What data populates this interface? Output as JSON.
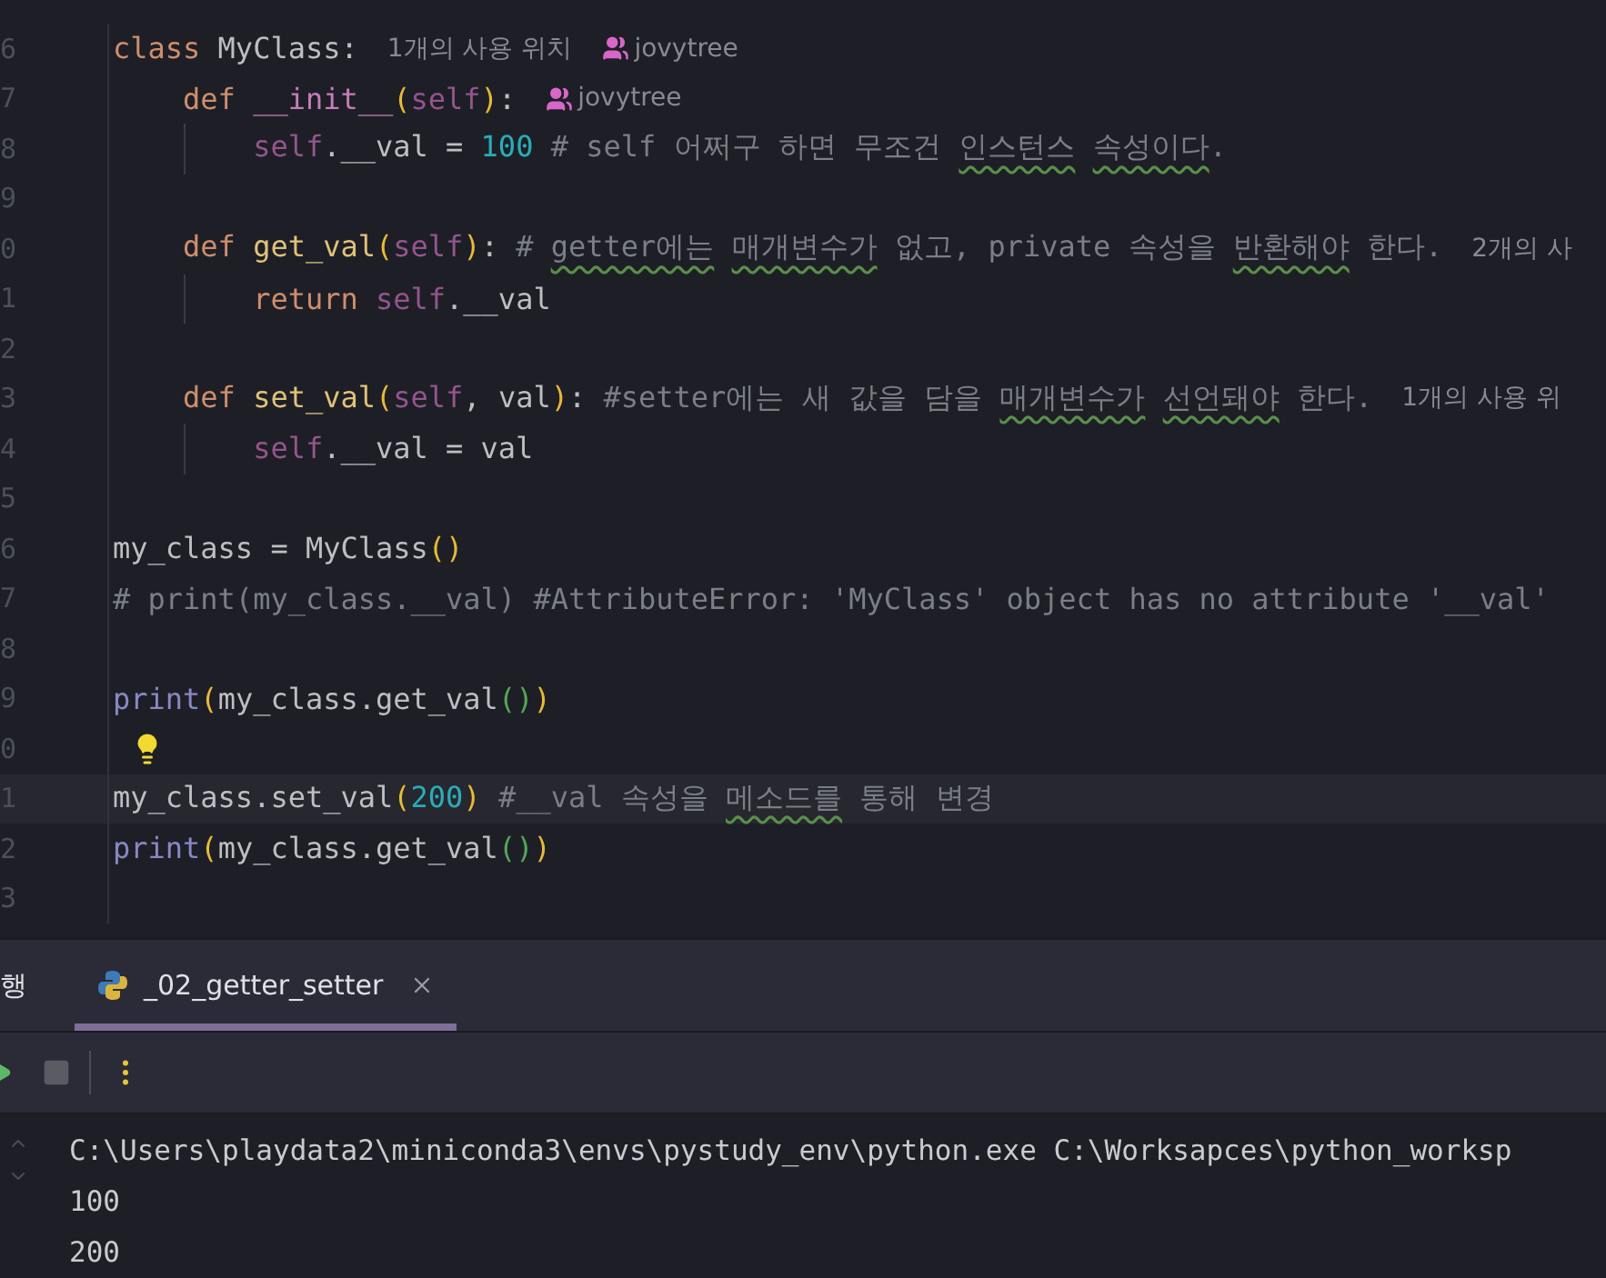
{
  "editor": {
    "lines": [
      {
        "number": "6",
        "tokens": [
          {
            "kind": "kw",
            "text": "class "
          },
          {
            "kind": "plain",
            "text": "MyClass"
          },
          {
            "kind": "plain",
            "text": ":"
          }
        ],
        "hints": [
          {
            "kind": "usages",
            "text": "1개의 사용 위치"
          },
          {
            "kind": "author",
            "text": "jovytree"
          }
        ]
      },
      {
        "number": "7",
        "tokens": [
          {
            "kind": "kw",
            "text": "    def "
          },
          {
            "kind": "magic",
            "text": "__init__"
          },
          {
            "kind": "p1",
            "text": "("
          },
          {
            "kind": "self",
            "text": "self"
          },
          {
            "kind": "p1",
            "text": ")"
          },
          {
            "kind": "plain",
            "text": ":"
          }
        ],
        "hints": [
          {
            "kind": "author",
            "text": "jovytree"
          }
        ]
      },
      {
        "number": "8",
        "guide": true,
        "tokens": [
          {
            "kind": "self",
            "text": "        self"
          },
          {
            "kind": "plain",
            "text": ".__val = "
          },
          {
            "kind": "num",
            "text": "100"
          },
          {
            "kind": "comment",
            "text": " # self 어쩌구 하면 무조건 "
          },
          {
            "kind": "typo",
            "text": "인스턴스"
          },
          {
            "kind": "typo",
            "text": " 속성이다"
          },
          {
            "kind": "comment",
            "text": "."
          }
        ]
      },
      {
        "number": "9"
      },
      {
        "number": "0",
        "tokens": [
          {
            "kind": "kw",
            "text": "    def "
          },
          {
            "kind": "fn",
            "text": "get_val"
          },
          {
            "kind": "p1",
            "text": "("
          },
          {
            "kind": "self",
            "text": "self"
          },
          {
            "kind": "p1",
            "text": ")"
          },
          {
            "kind": "plain",
            "text": ": "
          },
          {
            "kind": "comment",
            "text": "# "
          },
          {
            "kind": "typo",
            "text": "getter에는"
          },
          {
            "kind": "typo",
            "text": " 매개변수가"
          },
          {
            "kind": "comment",
            "text": " 없고, private 속성을 "
          },
          {
            "kind": "typo",
            "text": "반환해야"
          },
          {
            "kind": "comment",
            "text": " 한다."
          }
        ],
        "hints": [
          {
            "kind": "usages",
            "text": "2개의 사"
          }
        ]
      },
      {
        "number": "1",
        "guide": true,
        "tokens": [
          {
            "kind": "kw",
            "text": "        return "
          },
          {
            "kind": "self",
            "text": "self"
          },
          {
            "kind": "plain",
            "text": ".__val"
          }
        ]
      },
      {
        "number": "2"
      },
      {
        "number": "3",
        "tokens": [
          {
            "kind": "kw",
            "text": "    def "
          },
          {
            "kind": "fn",
            "text": "set_val"
          },
          {
            "kind": "p1",
            "text": "("
          },
          {
            "kind": "self",
            "text": "self"
          },
          {
            "kind": "plain",
            "text": ", val"
          },
          {
            "kind": "p1",
            "text": ")"
          },
          {
            "kind": "plain",
            "text": ": "
          },
          {
            "kind": "comment",
            "text": "#setter에는 새 값을 담을 "
          },
          {
            "kind": "typo",
            "text": "매개변수가"
          },
          {
            "kind": "typo",
            "text": " 선언돼야"
          },
          {
            "kind": "comment",
            "text": " 한다."
          }
        ],
        "hints": [
          {
            "kind": "usages",
            "text": "1개의 사용 위"
          }
        ]
      },
      {
        "number": "4",
        "guide": true,
        "tokens": [
          {
            "kind": "self",
            "text": "        self"
          },
          {
            "kind": "plain",
            "text": ".__val = val"
          }
        ]
      },
      {
        "number": "5"
      },
      {
        "number": "6",
        "tokens": [
          {
            "kind": "plain",
            "text": "my_class = MyClass"
          },
          {
            "kind": "p1",
            "text": "()"
          }
        ]
      },
      {
        "number": "7",
        "tokens": [
          {
            "kind": "comment",
            "text": "# print(my_class.__val) #AttributeError: 'MyClass' object has no attribute '__val'"
          }
        ]
      },
      {
        "number": "8"
      },
      {
        "number": "9",
        "tokens": [
          {
            "kind": "builtin",
            "text": "print"
          },
          {
            "kind": "p1",
            "text": "("
          },
          {
            "kind": "plain",
            "text": "my_class.get_val"
          },
          {
            "kind": "p2",
            "text": "()"
          },
          {
            "kind": "p1",
            "text": ")"
          }
        ]
      },
      {
        "number": "0",
        "bulb": true
      },
      {
        "number": "1",
        "current": true,
        "tokens": [
          {
            "kind": "plain",
            "text": "my_class.set_val"
          },
          {
            "kind": "p1",
            "text": "("
          },
          {
            "kind": "num",
            "text": "200"
          },
          {
            "kind": "p1",
            "text": ")"
          },
          {
            "kind": "comment",
            "text": " #__val 속성을 "
          },
          {
            "kind": "typo",
            "text": "메소드를"
          },
          {
            "kind": "comment",
            "text": " 통해 변경"
          }
        ]
      },
      {
        "number": "2",
        "tokens": [
          {
            "kind": "builtin",
            "text": "print"
          },
          {
            "kind": "p1",
            "text": "("
          },
          {
            "kind": "plain",
            "text": "my_class.get_val"
          },
          {
            "kind": "p2",
            "text": "()"
          },
          {
            "kind": "p1",
            "text": ")"
          }
        ]
      },
      {
        "number": "3"
      }
    ]
  },
  "run_panel": {
    "title": "행",
    "tabs": [
      {
        "label": "_02_getter_setter",
        "selected": true
      }
    ],
    "console": [
      "C:\\Users\\playdata2\\miniconda3\\envs\\pystudy_env\\python.exe C:\\Worksapces\\python_worksp",
      "100",
      "200"
    ]
  }
}
